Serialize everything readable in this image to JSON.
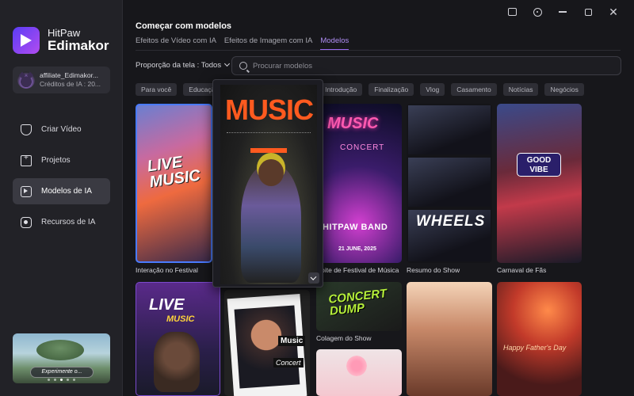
{
  "brand": {
    "name_top": "HitPaw",
    "name_bottom": "Edimakor"
  },
  "account": {
    "name": "affiliate_Edimakor...",
    "credits": "Créditos de IA : 20..."
  },
  "nav": [
    {
      "label": "Criar Vídeo",
      "icon": "video-plus-icon",
      "active": false
    },
    {
      "label": "Projetos",
      "icon": "folder-plus-icon",
      "active": false
    },
    {
      "label": "Modelos de IA",
      "icon": "template-icon",
      "active": true
    },
    {
      "label": "Recursos de IA",
      "icon": "ai-resources-icon",
      "active": false
    }
  ],
  "promo": {
    "button": "Experimente o...",
    "slides": 5,
    "active_slide": 1
  },
  "window": {
    "icons": [
      "feedback-icon",
      "info-icon",
      "minimize-icon",
      "maximize-icon",
      "close-icon"
    ]
  },
  "header": {
    "title": "Começar com modelos"
  },
  "tabs": [
    {
      "label": "Efeitos de Vídeo com IA",
      "active": false
    },
    {
      "label": "Efeitos de Imagem com IA",
      "active": false
    },
    {
      "label": "Modelos",
      "active": true
    }
  ],
  "filter": {
    "ratio_label": "Proporção da tela : Todos"
  },
  "search": {
    "placeholder": "Procurar modelos",
    "value": ""
  },
  "chips": [
    "Para você",
    "Educação",
    "Introdução",
    "Finalização",
    "Vlog",
    "Casamento",
    "Notícias",
    "Negócios"
  ],
  "cards": {
    "c1": {
      "caption": "Interação no Festival",
      "text": "LIVE MUSIC"
    },
    "c2": {
      "caption": "Noite de Festival de Música",
      "neon1": "MUSIC",
      "neon2": "CONCERT",
      "band": "HITPAW BAND",
      "date": "21 JUNE, 2025"
    },
    "c3": {
      "caption": "Resumo do Show",
      "text": "WHEELS"
    },
    "c4": {
      "caption": "Carnaval de Fãs",
      "text": "GOOD VIBE"
    },
    "c5": {
      "text1": "LIVE",
      "text2": "MUSIC"
    },
    "c6": {
      "caption": "Colagem do Show",
      "text": "CONCERT DUMP"
    },
    "c9": {
      "text": "Happy Father's Day"
    },
    "c10": {
      "text1": "Music",
      "text2": "Concert"
    }
  },
  "preview": {
    "title": "MUSIC"
  },
  "colors": {
    "accent": "#9b6cf2",
    "background": "#17171b",
    "sidebar": "#222227",
    "preview_title": "#ff5a1f"
  }
}
